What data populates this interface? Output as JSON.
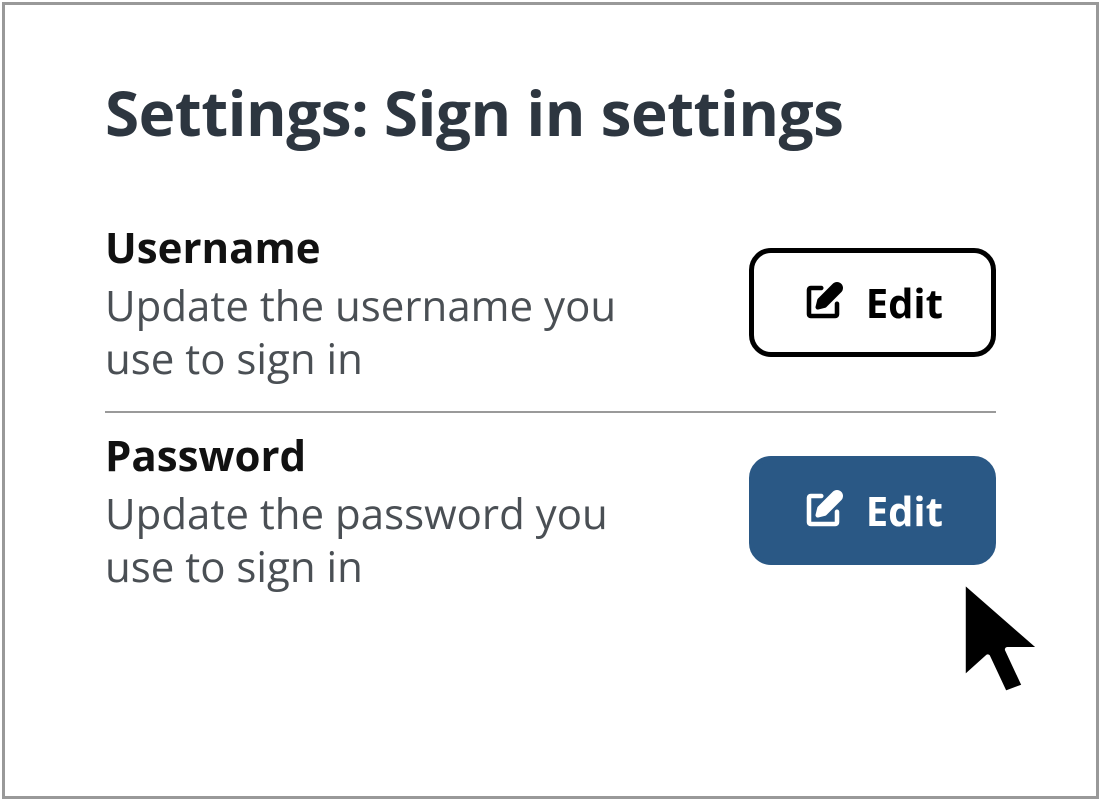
{
  "page": {
    "title": "Settings: Sign in settings"
  },
  "settings": [
    {
      "name": "Username",
      "description": "Update the username you use to sign in",
      "edit_label": "Edit"
    },
    {
      "name": "Password",
      "description": "Update the password you use to sign in",
      "edit_label": "Edit"
    }
  ]
}
